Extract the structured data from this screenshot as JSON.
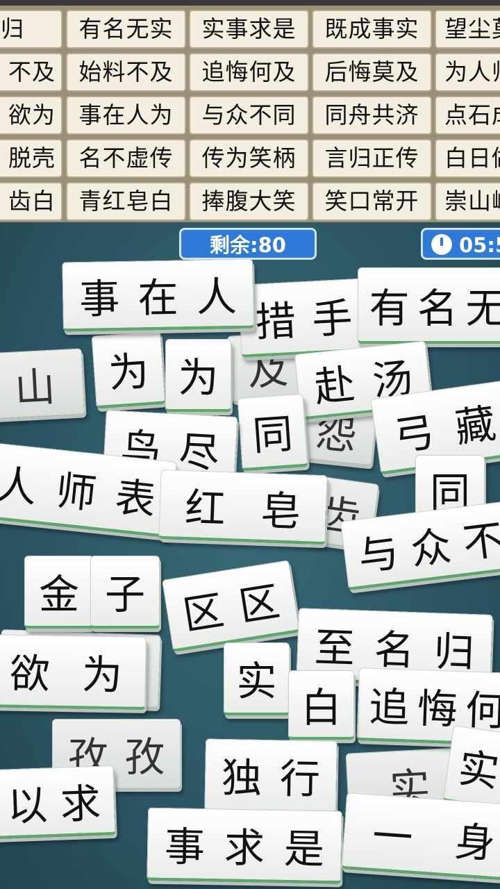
{
  "answer_grid": [
    [
      "名归",
      "有名无实",
      "实事求是",
      "既成事实",
      "望尘莫"
    ],
    [
      "不及",
      "始料不及",
      "追悔何及",
      "后悔莫及",
      "为人师"
    ],
    [
      "欲为",
      "事在人为",
      "与众不同",
      "同舟共济",
      "点石成"
    ],
    [
      "脱壳",
      "名不虚传",
      "传为笑柄",
      "言归正传",
      "白日做"
    ],
    [
      "齿白",
      "青红皂白",
      "捧腹大笑",
      "笑口常开",
      "崇山峻"
    ]
  ],
  "status": {
    "remaining": "剩余:80",
    "timer": "05:5"
  },
  "tiles": [
    "事在人",
    "措手",
    "有名无",
    "为",
    "为",
    "及",
    "赴汤",
    "同",
    "怨",
    "弓藏",
    "鸟尽",
    "人师表",
    "红皂",
    "齿",
    "同",
    "与众不",
    "金",
    "子",
    "区区",
    "至名归",
    "为",
    "欲为",
    "实",
    "追悔何",
    "白",
    "孜孜",
    "独行",
    "以求",
    "实",
    "事求是",
    "一身",
    "山"
  ],
  "icons": [
    "clock-icon"
  ]
}
